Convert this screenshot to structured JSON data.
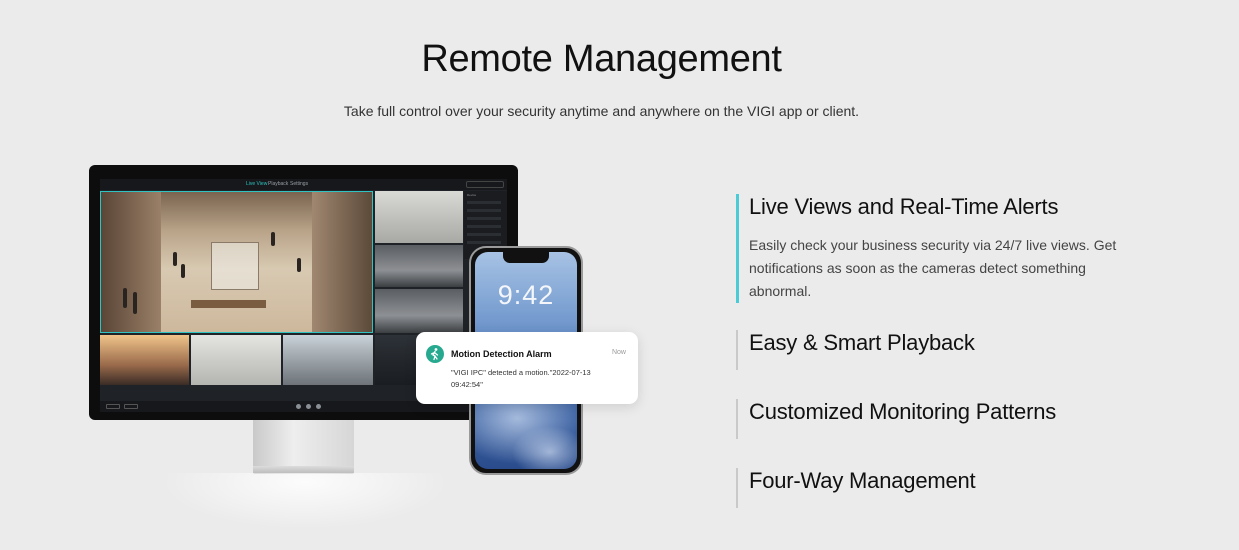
{
  "hero": {
    "title": "Remote Management",
    "subtitle": "Take full control over your security anytime and anywhere on the VIGI app or client."
  },
  "monitor_app": {
    "tabs": [
      "Live View",
      "Playback",
      "Settings"
    ],
    "active_tab": "Live View",
    "side_panel_header": "Device",
    "bottom_controls": [
      "Fullscreen",
      "Layout"
    ]
  },
  "phone": {
    "lock_time": "9:42"
  },
  "notification": {
    "title": "Motion Detection Alarm",
    "time": "Now",
    "body": "\"VIGI IPC\" detected a motion.\"2022-07-13 09:42:54\"",
    "icon": "person-walking-icon",
    "icon_color": "#27a990"
  },
  "features": [
    {
      "title": "Live Views and Real-Time Alerts",
      "description": "Easily check your business security via 24/7 live views. Get notifications as soon as the cameras detect something abnormal.",
      "active": true
    },
    {
      "title": "Easy & Smart Playback",
      "active": false
    },
    {
      "title": "Customized Monitoring Patterns",
      "active": false
    },
    {
      "title": "Four-Way Management",
      "active": false
    }
  ],
  "colors": {
    "background": "#ebebeb",
    "accent": "#4acbd6",
    "inactive_border": "#c9c9c9"
  }
}
